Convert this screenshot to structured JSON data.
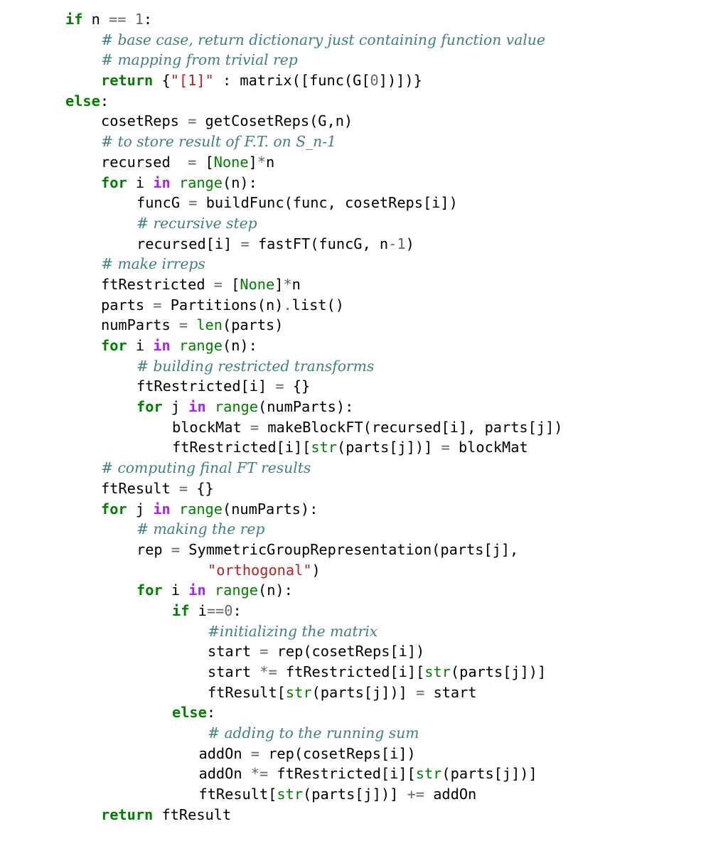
{
  "document": {
    "type": "code-listing",
    "language": "python",
    "colors": {
      "keyword": "#008000",
      "operator_word": "#aa22ff",
      "builtin": "#008000",
      "number": "#666666",
      "operator": "#666666",
      "string": "#ba2121",
      "comment": "#408080",
      "text": "#000000"
    },
    "lines": [
      {
        "indent": 0,
        "tokens": [
          [
            "kw",
            "if"
          ],
          [
            "name",
            " n "
          ],
          [
            "op",
            "=="
          ],
          [
            "name",
            " "
          ],
          [
            "num",
            "1"
          ],
          [
            "name",
            ":"
          ]
        ]
      },
      {
        "indent": 1,
        "tokens": [
          [
            "com",
            "# base case, return dictionary just containing function value"
          ]
        ]
      },
      {
        "indent": 1,
        "tokens": [
          [
            "com",
            "# mapping from trivial rep"
          ]
        ]
      },
      {
        "indent": 1,
        "tokens": [
          [
            "kw",
            "return"
          ],
          [
            "name",
            " {"
          ],
          [
            "str",
            "\"[1]\""
          ],
          [
            "name",
            " : matrix([func(G["
          ],
          [
            "num",
            "0"
          ],
          [
            "name",
            "])])}"
          ]
        ]
      },
      {
        "indent": 0,
        "tokens": [
          [
            "kw",
            "else"
          ],
          [
            "name",
            ":"
          ]
        ]
      },
      {
        "indent": 1,
        "tokens": [
          [
            "name",
            "cosetReps "
          ],
          [
            "op",
            "="
          ],
          [
            "name",
            " getCosetReps(G,n)"
          ]
        ]
      },
      {
        "indent": 1,
        "tokens": [
          [
            "com",
            "# to store result of F.T. on S_n-1"
          ]
        ]
      },
      {
        "indent": 1,
        "tokens": [
          [
            "name",
            "recursed  "
          ],
          [
            "op",
            "="
          ],
          [
            "name",
            " ["
          ],
          [
            "bi",
            "None"
          ],
          [
            "name",
            "]"
          ],
          [
            "op",
            "*"
          ],
          [
            "name",
            "n"
          ]
        ]
      },
      {
        "indent": 1,
        "tokens": [
          [
            "kw",
            "for"
          ],
          [
            "name",
            " i "
          ],
          [
            "in",
            "in"
          ],
          [
            "name",
            " "
          ],
          [
            "bi",
            "range"
          ],
          [
            "name",
            "(n):"
          ]
        ]
      },
      {
        "indent": 2,
        "tokens": [
          [
            "name",
            "funcG "
          ],
          [
            "op",
            "="
          ],
          [
            "name",
            " buildFunc(func, cosetReps[i])"
          ]
        ]
      },
      {
        "indent": 2,
        "tokens": [
          [
            "com",
            "# recursive step"
          ]
        ]
      },
      {
        "indent": 2,
        "tokens": [
          [
            "name",
            "recursed[i] "
          ],
          [
            "op",
            "="
          ],
          [
            "name",
            " fastFT(funcG, n"
          ],
          [
            "op",
            "-"
          ],
          [
            "num",
            "1"
          ],
          [
            "name",
            ")"
          ]
        ]
      },
      {
        "indent": 1,
        "tokens": [
          [
            "com",
            "# make irreps"
          ]
        ]
      },
      {
        "indent": 1,
        "tokens": [
          [
            "name",
            "ftRestricted "
          ],
          [
            "op",
            "="
          ],
          [
            "name",
            " ["
          ],
          [
            "bi",
            "None"
          ],
          [
            "name",
            "]"
          ],
          [
            "op",
            "*"
          ],
          [
            "name",
            "n"
          ]
        ]
      },
      {
        "indent": 1,
        "tokens": [
          [
            "name",
            "parts "
          ],
          [
            "op",
            "="
          ],
          [
            "name",
            " Partitions(n)"
          ],
          [
            "op",
            "."
          ],
          [
            "name",
            "list()"
          ]
        ]
      },
      {
        "indent": 1,
        "tokens": [
          [
            "name",
            "numParts "
          ],
          [
            "op",
            "="
          ],
          [
            "name",
            " "
          ],
          [
            "bi",
            "len"
          ],
          [
            "name",
            "(parts)"
          ]
        ]
      },
      {
        "indent": 1,
        "tokens": [
          [
            "kw",
            "for"
          ],
          [
            "name",
            " i "
          ],
          [
            "in",
            "in"
          ],
          [
            "name",
            " "
          ],
          [
            "bi",
            "range"
          ],
          [
            "name",
            "(n):"
          ]
        ]
      },
      {
        "indent": 2,
        "tokens": [
          [
            "com",
            "# building restricted transforms"
          ]
        ]
      },
      {
        "indent": 2,
        "tokens": [
          [
            "name",
            "ftRestricted[i] "
          ],
          [
            "op",
            "="
          ],
          [
            "name",
            " {}"
          ]
        ]
      },
      {
        "indent": 2,
        "tokens": [
          [
            "kw",
            "for"
          ],
          [
            "name",
            " j "
          ],
          [
            "in",
            "in"
          ],
          [
            "name",
            " "
          ],
          [
            "bi",
            "range"
          ],
          [
            "name",
            "(numParts):"
          ]
        ]
      },
      {
        "indent": 3,
        "tokens": [
          [
            "name",
            "blockMat "
          ],
          [
            "op",
            "="
          ],
          [
            "name",
            " makeBlockFT(recursed[i], parts[j])"
          ]
        ]
      },
      {
        "indent": 3,
        "tokens": [
          [
            "name",
            "ftRestricted[i]["
          ],
          [
            "bi",
            "str"
          ],
          [
            "name",
            "(parts[j])] "
          ],
          [
            "op",
            "="
          ],
          [
            "name",
            " blockMat"
          ]
        ]
      },
      {
        "indent": 1,
        "tokens": [
          [
            "com",
            "# computing final FT results"
          ]
        ]
      },
      {
        "indent": 1,
        "tokens": [
          [
            "name",
            "ftResult "
          ],
          [
            "op",
            "="
          ],
          [
            "name",
            " {}"
          ]
        ]
      },
      {
        "indent": 1,
        "tokens": [
          [
            "kw",
            "for"
          ],
          [
            "name",
            " j "
          ],
          [
            "in",
            "in"
          ],
          [
            "name",
            " "
          ],
          [
            "bi",
            "range"
          ],
          [
            "name",
            "(numParts):"
          ]
        ]
      },
      {
        "indent": 2,
        "tokens": [
          [
            "com",
            "# making the rep"
          ]
        ]
      },
      {
        "indent": 2,
        "tokens": [
          [
            "name",
            "rep "
          ],
          [
            "op",
            "="
          ],
          [
            "name",
            " SymmetricGroupRepresentation(parts[j],"
          ]
        ]
      },
      {
        "indent": 4,
        "pad": 0.0,
        "tokens": [
          [
            "str",
            "\"orthogonal\""
          ],
          [
            "name",
            ")"
          ]
        ]
      },
      {
        "indent": 2,
        "tokens": [
          [
            "kw",
            "for"
          ],
          [
            "name",
            " i "
          ],
          [
            "in",
            "in"
          ],
          [
            "name",
            " "
          ],
          [
            "bi",
            "range"
          ],
          [
            "name",
            "(n):"
          ]
        ]
      },
      {
        "indent": 3,
        "tokens": [
          [
            "kw",
            "if"
          ],
          [
            "name",
            " i"
          ],
          [
            "op",
            "=="
          ],
          [
            "num",
            "0"
          ],
          [
            "name",
            ":"
          ]
        ]
      },
      {
        "indent": 4,
        "tokens": [
          [
            "com",
            "#initializing the matrix"
          ]
        ]
      },
      {
        "indent": 4,
        "tokens": [
          [
            "name",
            "start "
          ],
          [
            "op",
            "="
          ],
          [
            "name",
            " rep(cosetReps[i])"
          ]
        ]
      },
      {
        "indent": 4,
        "tokens": [
          [
            "name",
            "start "
          ],
          [
            "op",
            "*="
          ],
          [
            "name",
            " ftRestricted[i]["
          ],
          [
            "bi",
            "str"
          ],
          [
            "name",
            "(parts[j])]"
          ]
        ]
      },
      {
        "indent": 4,
        "tokens": [
          [
            "name",
            "ftResult["
          ],
          [
            "bi",
            "str"
          ],
          [
            "name",
            "(parts[j])] "
          ],
          [
            "op",
            "="
          ],
          [
            "name",
            " start"
          ]
        ]
      },
      {
        "indent": 3,
        "tokens": [
          [
            "kw",
            "else"
          ],
          [
            "name",
            ":"
          ]
        ]
      },
      {
        "indent": 4,
        "tokens": [
          [
            "com",
            "# adding to the running sum"
          ]
        ]
      },
      {
        "indent": 3.75,
        "tokens": [
          [
            "name",
            "addOn "
          ],
          [
            "op",
            "="
          ],
          [
            "name",
            " rep(cosetReps[i])"
          ]
        ]
      },
      {
        "indent": 3.75,
        "tokens": [
          [
            "name",
            "addOn "
          ],
          [
            "op",
            "*="
          ],
          [
            "name",
            " ftRestricted[i]["
          ],
          [
            "bi",
            "str"
          ],
          [
            "name",
            "(parts[j])]"
          ]
        ]
      },
      {
        "indent": 3.75,
        "tokens": [
          [
            "name",
            "ftResult["
          ],
          [
            "bi",
            "str"
          ],
          [
            "name",
            "(parts[j])] "
          ],
          [
            "op",
            "+="
          ],
          [
            "name",
            " addOn"
          ]
        ]
      },
      {
        "indent": 1,
        "tokens": [
          [
            "kw",
            "return"
          ],
          [
            "name",
            " ftResult"
          ]
        ]
      }
    ]
  }
}
